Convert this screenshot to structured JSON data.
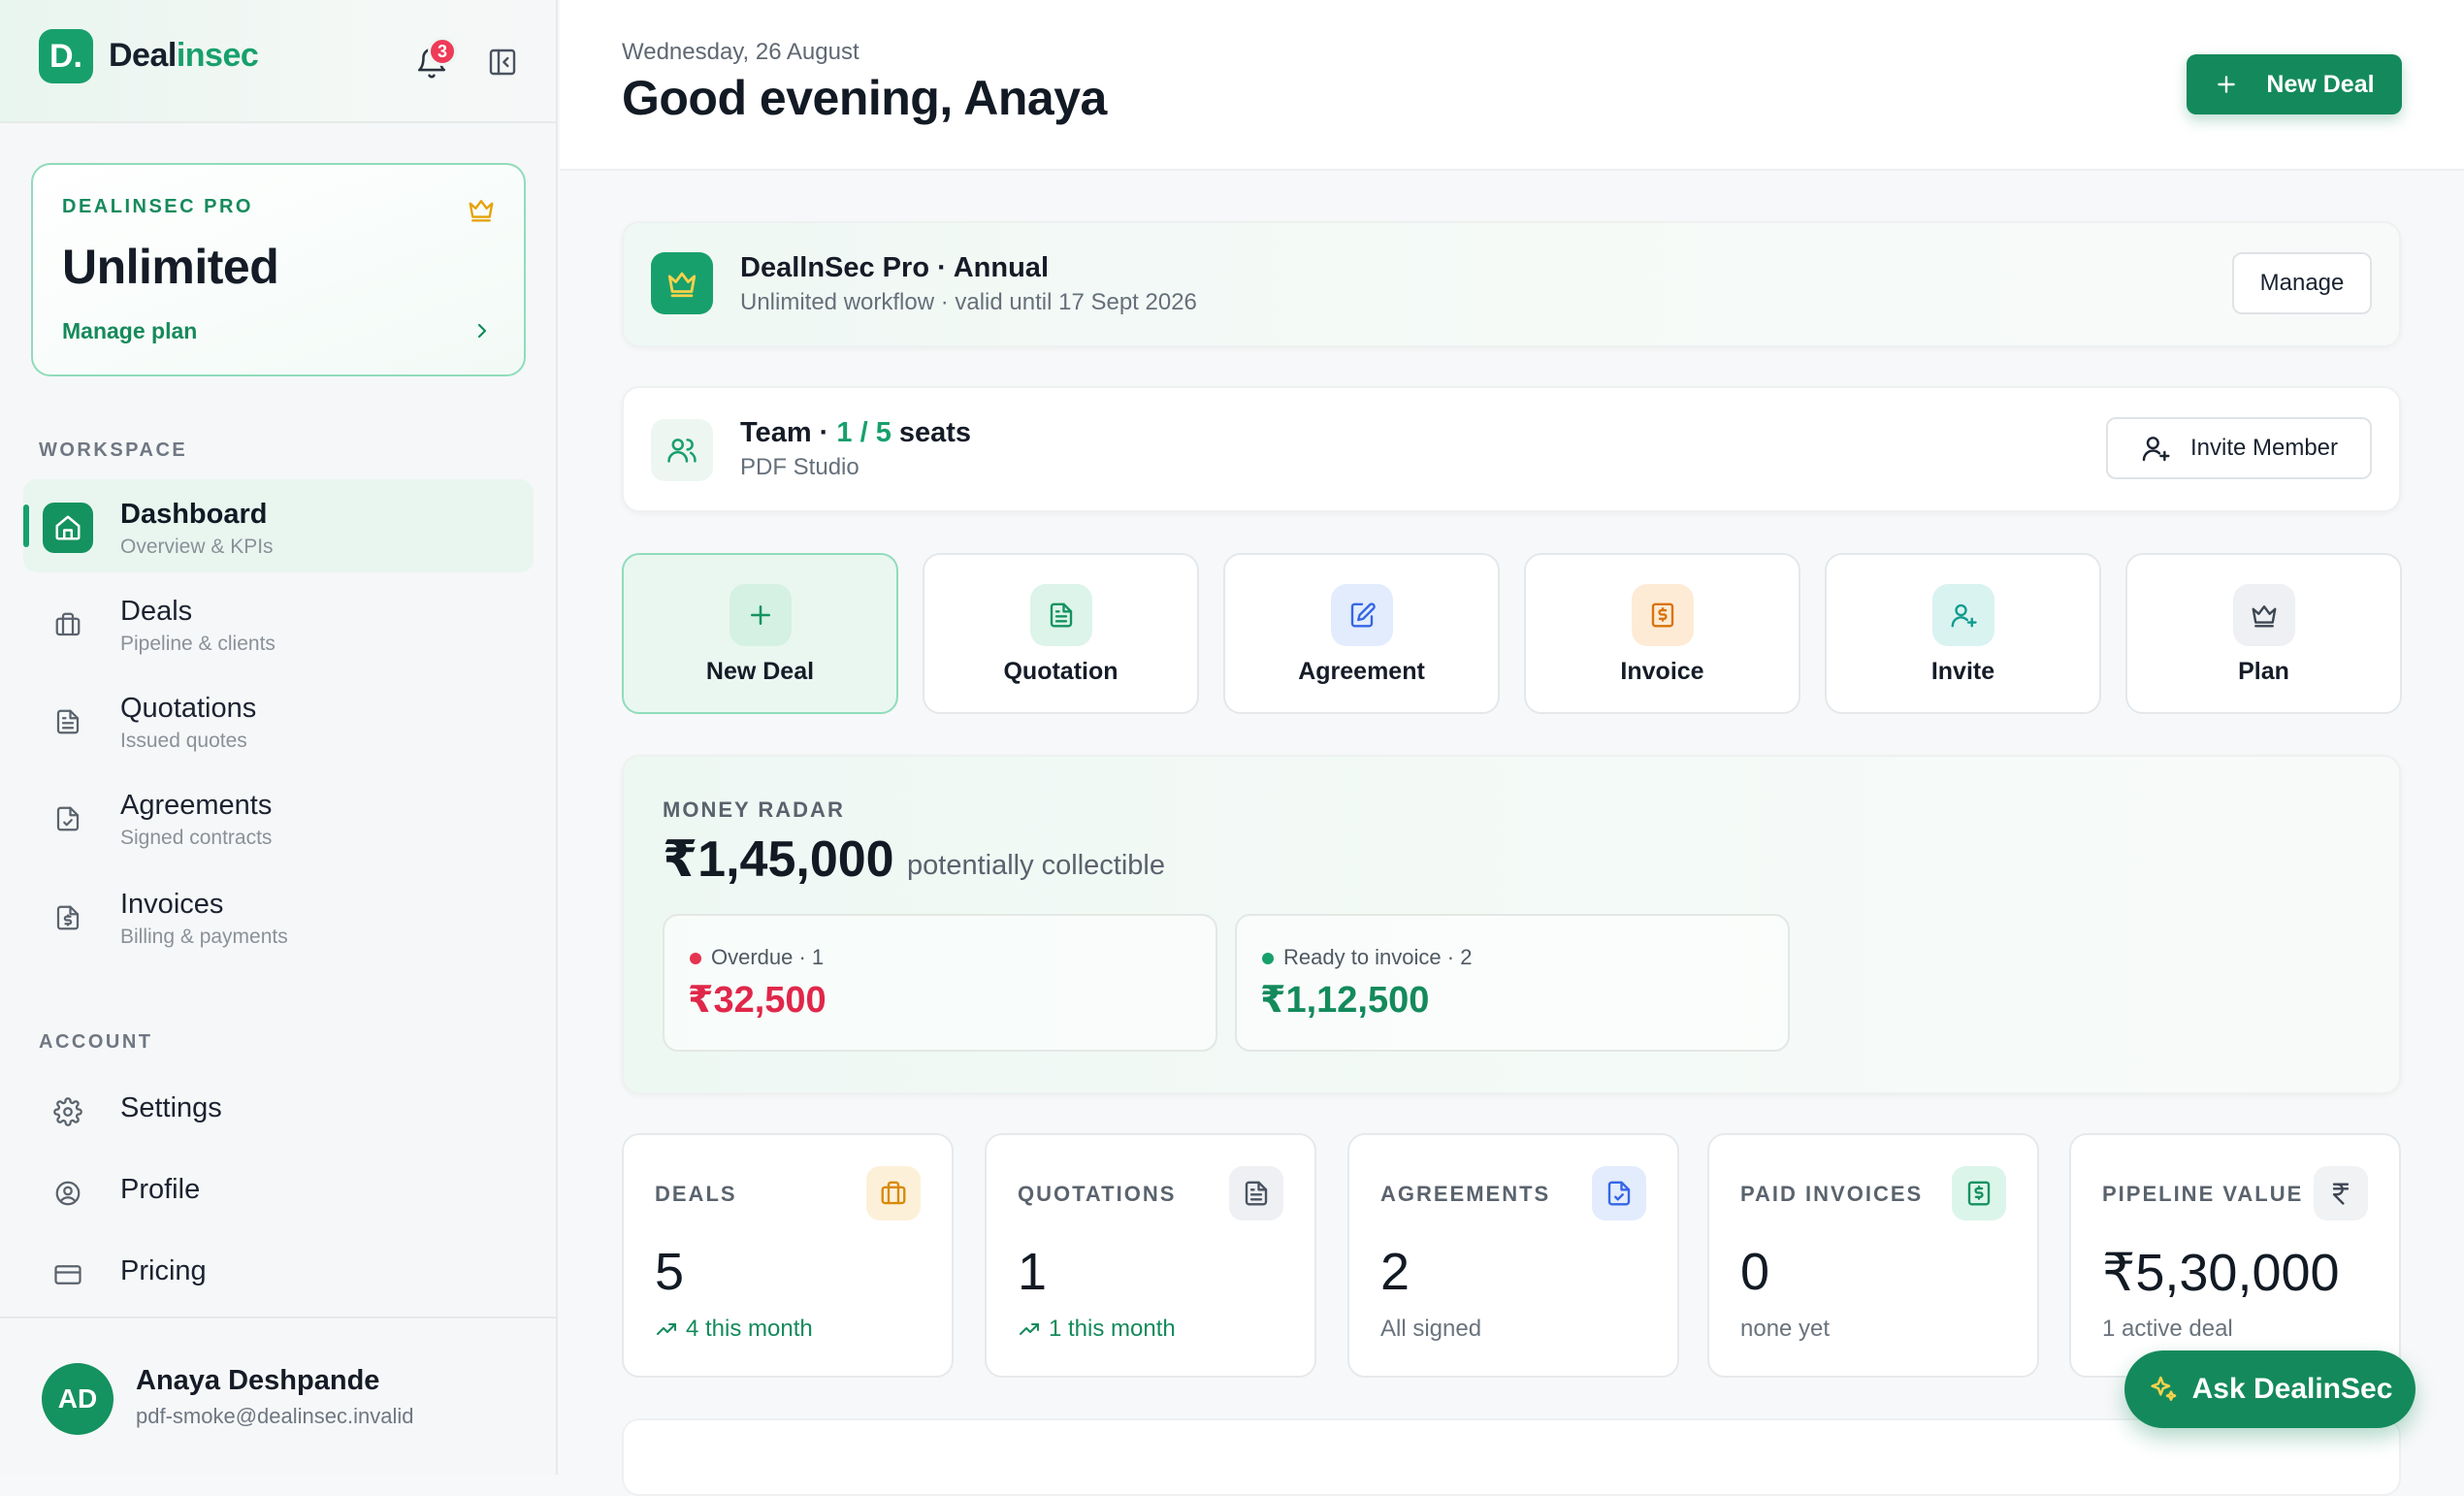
{
  "brand": {
    "initial": "D.",
    "name_part1": "Deal",
    "name_part2": "insec",
    "notification_count": "3"
  },
  "plan_card": {
    "eyebrow": "DEALINSEC PRO",
    "title": "Unlimited",
    "manage_label": "Manage plan"
  },
  "sidebar": {
    "workspace_label": "WORKSPACE",
    "workspace_items": [
      {
        "label": "Dashboard",
        "sub": "Overview & KPIs",
        "icon": "home-icon"
      },
      {
        "label": "Deals",
        "sub": "Pipeline & clients",
        "icon": "briefcase-icon"
      },
      {
        "label": "Quotations",
        "sub": "Issued quotes",
        "icon": "document-icon"
      },
      {
        "label": "Agreements",
        "sub": "Signed contracts",
        "icon": "file-check-icon"
      },
      {
        "label": "Invoices",
        "sub": "Billing & payments",
        "icon": "invoice-icon"
      }
    ],
    "account_label": "ACCOUNT",
    "account_items": [
      {
        "label": "Settings",
        "icon": "gear-icon"
      },
      {
        "label": "Profile",
        "icon": "user-circle-icon"
      },
      {
        "label": "Pricing",
        "icon": "card-icon"
      }
    ]
  },
  "user": {
    "initials": "AD",
    "name": "Anaya Deshpande",
    "email": "pdf-smoke@dealinsec.invalid"
  },
  "header": {
    "date": "Wednesday, 26 August",
    "greeting": "Good evening, Anaya",
    "new_deal_label": "New Deal"
  },
  "subscription": {
    "title": "DeallnSec Pro · Annual",
    "subtitle": "Unlimited workflow · valid until 17 Sept 2026",
    "manage_label": "Manage"
  },
  "team": {
    "title_prefix": "Team · ",
    "seats_used": "1 / 5",
    "title_suffix": " seats",
    "subtitle": "PDF Studio",
    "invite_label": "Invite Member"
  },
  "quick_actions": [
    {
      "label": "New Deal",
      "icon": "plus-icon"
    },
    {
      "label": "Quotation",
      "icon": "document-icon"
    },
    {
      "label": "Agreement",
      "icon": "edit-file-icon"
    },
    {
      "label": "Invoice",
      "icon": "invoice-icon"
    },
    {
      "label": "Invite",
      "icon": "user-plus-icon"
    },
    {
      "label": "Plan",
      "icon": "crown-icon"
    }
  ],
  "money_radar": {
    "label": "MONEY RADAR",
    "amount": "₹1,45,000",
    "suffix": "potentially collectible",
    "overdue": {
      "label": "Overdue · 1",
      "value": "₹32,500",
      "color": "#e0274a"
    },
    "ready": {
      "label": "Ready to invoice · 2",
      "value": "₹1,12,500",
      "color": "#148a5c"
    }
  },
  "kpis": [
    {
      "label": "DEALS",
      "value": "5",
      "sub": "4 this month",
      "trend": true,
      "icon": "briefcase-icon",
      "icon_bg": "#fdf0d9",
      "icon_color": "#d98a0b"
    },
    {
      "label": "QUOTATIONS",
      "value": "1",
      "sub": "1 this month",
      "trend": true,
      "icon": "document-icon",
      "icon_bg": "#eef0f3",
      "icon_color": "#4a5360"
    },
    {
      "label": "AGREEMENTS",
      "value": "2",
      "sub": "All signed",
      "trend": false,
      "icon": "file-check-icon",
      "icon_bg": "#e3ecfd",
      "icon_color": "#3566e6"
    },
    {
      "label": "PAID INVOICES",
      "value": "0",
      "sub": "none yet",
      "trend": false,
      "icon": "invoice-icon",
      "icon_bg": "#dcf5ea",
      "icon_color": "#14925f"
    },
    {
      "label": "PIPELINE VALUE",
      "value": "₹5,30,000",
      "sub": "1 active deal",
      "trend": false,
      "icon": "rupee-icon",
      "icon_bg": "#f0f2f4",
      "icon_color": "#3d4652"
    }
  ],
  "assistant": {
    "label": "Ask DealinSec"
  },
  "colors": {
    "accent": "#18a06c",
    "accent_dark": "#148a5c",
    "danger": "#e0274a",
    "badge": "#ee3b57"
  }
}
